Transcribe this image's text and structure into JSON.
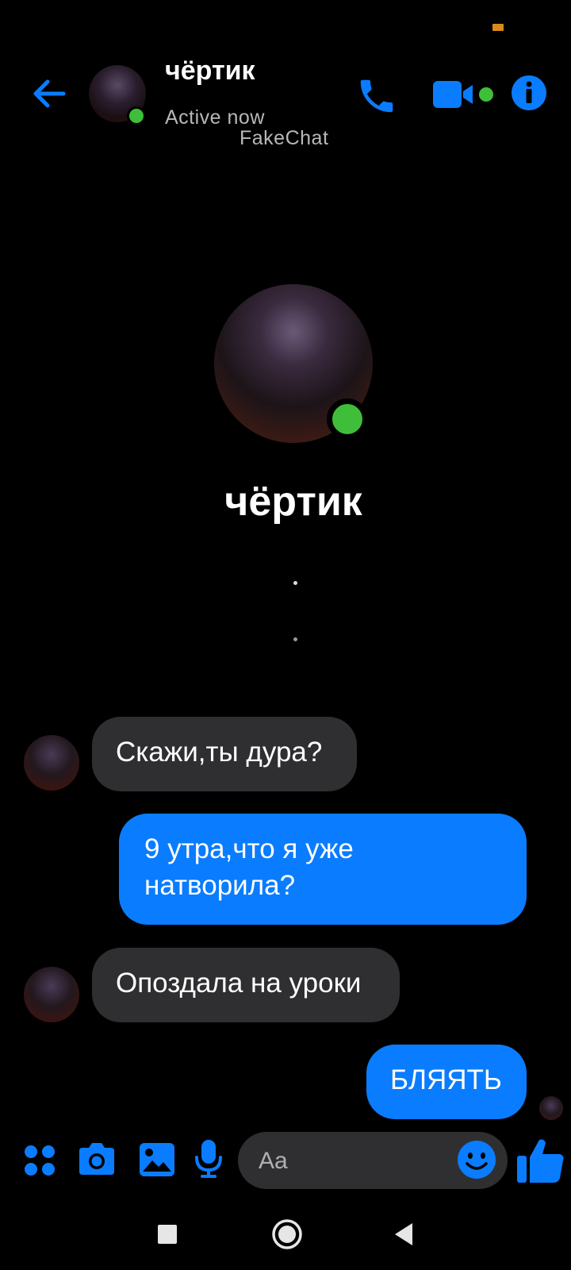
{
  "status_bar": {
    "indicator_color": "#d98b1a"
  },
  "header": {
    "contact_name": "чёртик",
    "status": "Active now",
    "watermark": "FakeChat",
    "online_color": "#3fbe3a",
    "accent_color": "#0a7cff",
    "icons": [
      "back-arrow-icon",
      "phone-icon",
      "video-camera-icon",
      "info-icon"
    ]
  },
  "profile": {
    "name": "чёртик"
  },
  "messages": [
    {
      "direction": "incoming",
      "text": "Скажи,ты дура?"
    },
    {
      "direction": "outgoing",
      "lines": [
        "9 утра,что я уже",
        "натворила?"
      ]
    },
    {
      "direction": "incoming",
      "text": "Опоздала на уроки"
    },
    {
      "direction": "outgoing",
      "text": "БЛЯЯТЬ"
    }
  ],
  "composer": {
    "placeholder": "Aa",
    "icons": [
      "apps-menu-icon",
      "camera-icon",
      "gallery-icon",
      "microphone-icon",
      "emoji-icon",
      "thumbs-up-icon"
    ]
  },
  "nav_bar": {
    "icons": [
      "recents-square-icon",
      "home-circle-icon",
      "back-triangle-icon"
    ]
  }
}
